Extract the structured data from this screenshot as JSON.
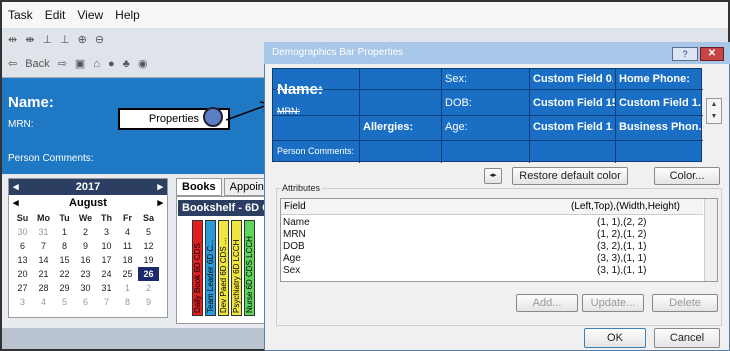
{
  "menu": [
    "Task",
    "Edit",
    "View",
    "Help"
  ],
  "toolbar": {
    "back": "Back"
  },
  "left": {
    "name": "Name:",
    "mrn": "MRN:",
    "person_comments": "Person Comments:",
    "properties": "Properties"
  },
  "calendar": {
    "year": "2017",
    "month": "August",
    "dow": [
      "Su",
      "Mo",
      "Tu",
      "We",
      "Th",
      "Fr",
      "Sa"
    ],
    "weeks": [
      [
        "30",
        "31",
        "1",
        "2",
        "3",
        "4",
        "5"
      ],
      [
        "6",
        "7",
        "8",
        "9",
        "10",
        "11",
        "12"
      ],
      [
        "13",
        "14",
        "15",
        "16",
        "17",
        "18",
        "19"
      ],
      [
        "20",
        "21",
        "22",
        "23",
        "24",
        "25",
        "26"
      ],
      [
        "27",
        "28",
        "29",
        "30",
        "31",
        "1",
        "2"
      ],
      [
        "3",
        "4",
        "5",
        "6",
        "7",
        "8",
        "9"
      ]
    ],
    "selected": "26"
  },
  "tabs": [
    "Books",
    "Appointme"
  ],
  "bookshelf": {
    "title": "Bookshelf - 6D C",
    "spines": [
      {
        "label": "Daily Book 6D CDS",
        "color": "#e02020"
      },
      {
        "label": "Team Leader 6D C...",
        "color": "#2b9bd8"
      },
      {
        "label": "Dev Paed 6D CDS ...",
        "color": "#f0e640"
      },
      {
        "label": "Psychiatry 6D LCCH",
        "color": "#f0e640"
      },
      {
        "label": "Nurse 6D CDS LCCH",
        "color": "#5cd65c"
      }
    ]
  },
  "dialog": {
    "title": "Demographics Bar Properties",
    "help": "?",
    "grid": {
      "name": "Name:",
      "mrn": "MRN:",
      "allergies": "Allergies:",
      "person_comments": "Person Comments:",
      "sex": "Sex:",
      "dob": "DOB:",
      "age": "Age:",
      "c1": "Custom Field 0...",
      "c2": "Custom Field 15:",
      "c3": "Custom Field 1...",
      "d1": "Home Phone:",
      "d2": "Custom Field 1...",
      "d3": "Business Phon..."
    },
    "restore": "Restore default color",
    "color": "Color...",
    "attributes": "Attributes",
    "columns": {
      "field": "Field",
      "pos": "(Left,Top),(Width,Height)"
    },
    "rows": [
      {
        "field": "Name",
        "pos": "(1, 1),(2, 2)"
      },
      {
        "field": "MRN",
        "pos": "(1, 2),(1, 2)"
      },
      {
        "field": "DOB",
        "pos": "(3, 2),(1, 1)"
      },
      {
        "field": "Age",
        "pos": "(3, 3),(1, 1)"
      },
      {
        "field": "Sex",
        "pos": "(3, 1),(1, 1)"
      }
    ],
    "add": "Add...",
    "update": "Update...",
    "delete": "Delete",
    "ok": "OK",
    "cancel": "Cancel"
  },
  "colors": {
    "accent": "#1f78c4",
    "dark": "#2d3e63"
  }
}
